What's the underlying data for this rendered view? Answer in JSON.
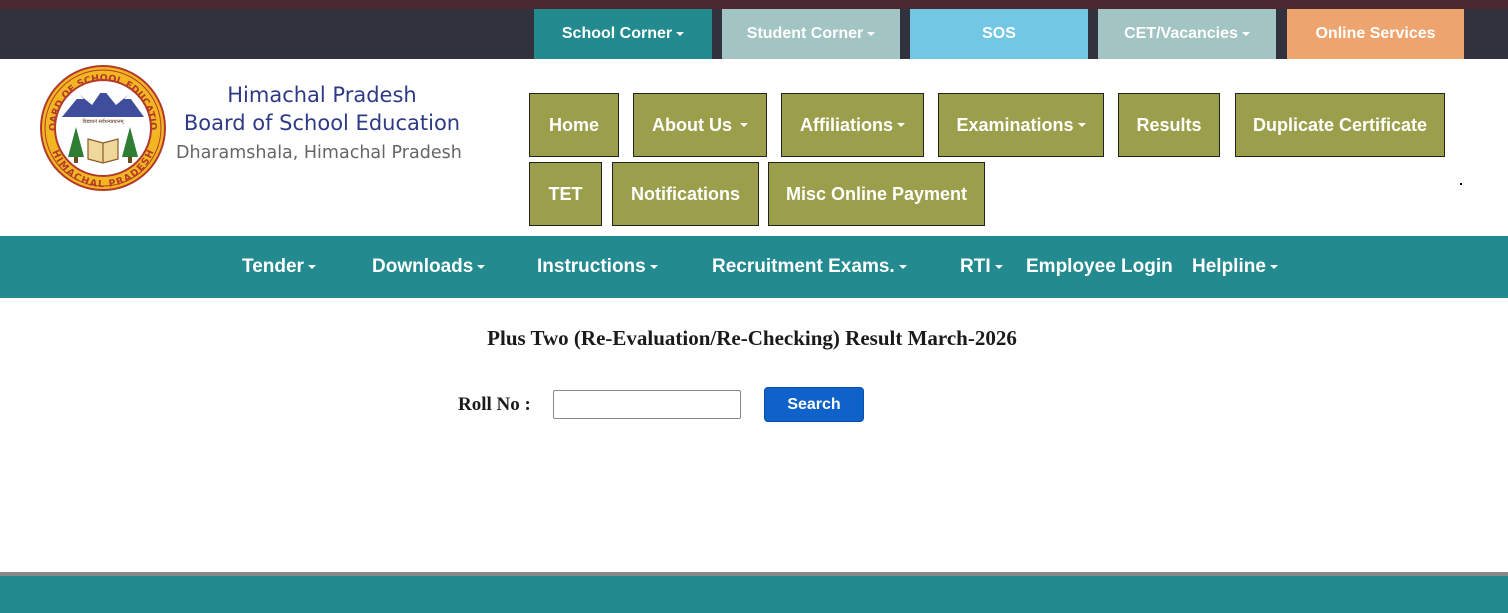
{
  "top_nav": {
    "items": [
      {
        "label": "School Corner",
        "has_caret": true,
        "color": "#238a8f"
      },
      {
        "label": "Student Corner",
        "has_caret": true,
        "color": "#a2c4c3"
      },
      {
        "label": "SOS",
        "has_caret": false,
        "color": "#72c7e3"
      },
      {
        "label": "CET/Vacancies",
        "has_caret": true,
        "color": "#a2c4c3"
      },
      {
        "label": "Online Services",
        "has_caret": false,
        "color": "#eea46f"
      }
    ]
  },
  "brand": {
    "line1": "Himachal Pradesh",
    "line2": "Board of School Education",
    "line3": "Dharamshala, Himachal Pradesh",
    "seal_top_text": "BOARD OF SCHOOL EDUCATION",
    "seal_bottom_text": "HIMACHAL PRADESH",
    "seal_center_text": "विद्याधनं सर्वधनप्रधानम्"
  },
  "main_nav": {
    "row1": [
      {
        "label": "Home",
        "has_caret": false
      },
      {
        "label": "About Us",
        "has_caret": true
      },
      {
        "label": "Affiliations",
        "has_caret": true
      },
      {
        "label": "Examinations",
        "has_caret": true
      },
      {
        "label": "Results",
        "has_caret": false
      },
      {
        "label": "Duplicate Certificate",
        "has_caret": false
      }
    ],
    "row2": [
      {
        "label": "TET",
        "has_caret": false
      },
      {
        "label": "Notifications",
        "has_caret": false
      },
      {
        "label": "Misc Online Payment",
        "has_caret": false
      }
    ],
    "color": "#9b9f4b"
  },
  "sub_nav": {
    "items": [
      {
        "label": "Tender",
        "has_caret": true
      },
      {
        "label": "Downloads",
        "has_caret": true
      },
      {
        "label": "Instructions",
        "has_caret": true
      },
      {
        "label": "Recruitment Exams.",
        "has_caret": true
      },
      {
        "label": "RTI",
        "has_caret": true
      },
      {
        "label": "Employee Login",
        "has_caret": false
      },
      {
        "label": "Helpline",
        "has_caret": true
      }
    ],
    "color": "#238a8f"
  },
  "form": {
    "title": "Plus Two (Re-Evaluation/Re-Checking) Result March-2026",
    "roll_label": "Roll No :",
    "roll_value": "",
    "search_label": "Search"
  }
}
